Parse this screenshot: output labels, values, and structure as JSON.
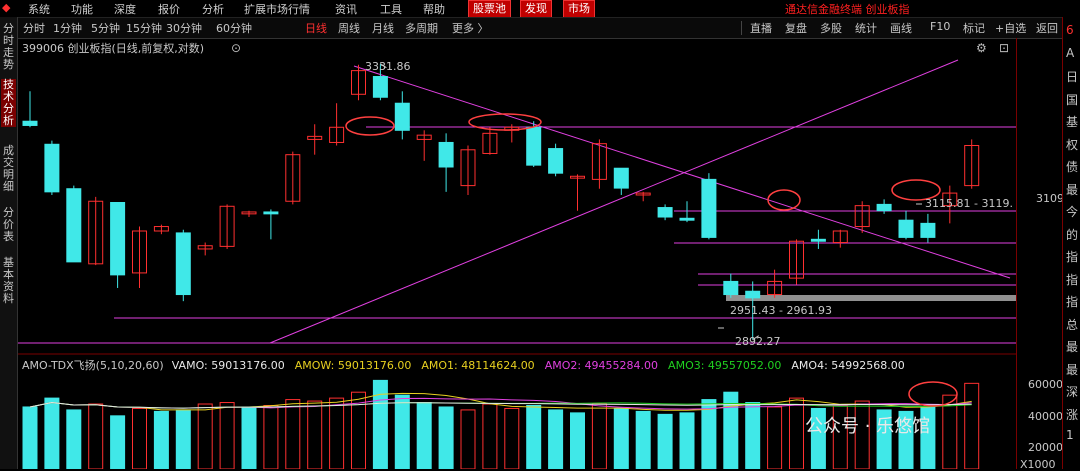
{
  "menu": {
    "items": [
      "系统",
      "功能",
      "深度",
      "报价",
      "分析",
      "扩展市场行情",
      "资讯",
      "工具",
      "帮助"
    ],
    "highlight": [
      "股票池",
      "发现",
      "市场"
    ],
    "right_text": "通达信金融终端  创业板指"
  },
  "toolbar": {
    "periods": [
      "分时",
      "1分钟",
      "5分钟",
      "15分钟",
      "30分钟",
      "60分钟",
      "日线",
      "周线",
      "月线",
      "多周期",
      "更多 〉"
    ],
    "active": "日线",
    "right": [
      "直播",
      "复盘",
      "多股",
      "统计",
      "画线",
      "F10",
      "标记",
      "+自选",
      "返回"
    ]
  },
  "left_tabs": [
    "分时走势",
    "技术分析",
    "成交明细",
    "分价表",
    "基本资料"
  ],
  "left_tab_active": "技术分析",
  "right_panel_chars": [
    "6",
    "A",
    "日",
    "国",
    "基",
    "权",
    "债",
    "最",
    "今",
    "的",
    "指",
    "指",
    "指",
    "总",
    "最",
    "最",
    "深",
    "涨",
    "1"
  ],
  "chart_title": "399006 创业板指(日线,前复权,对数)",
  "volume_legend": [
    {
      "text": "AMO-TDX飞扬(5,10,20,60)",
      "color": "#c8c8c8"
    },
    {
      "text": "VAMO: 59013176.00",
      "color": "#e8e8e8"
    },
    {
      "text": "AMOW: 59013176.00",
      "color": "#e8d020"
    },
    {
      "text": "AMO1: 48114624.00",
      "color": "#e8d020"
    },
    {
      "text": "AMO2: 49455284.00",
      "color": "#e040e0"
    },
    {
      "text": "AMO3: 49557052.00",
      "color": "#20d020"
    },
    {
      "text": "AMO4: 54992568.00",
      "color": "#e8e8e8"
    }
  ],
  "annotations": {
    "high": "3331.86",
    "low": "2892.27",
    "range1": "2951.43 - 2961.93",
    "range2": "3115.81 - 3119."
  },
  "price_axis": {
    "label": "3109"
  },
  "volume_axis": {
    "labels": [
      "60000",
      "40000",
      "20000"
    ],
    "unit": "X1000"
  },
  "watermark": "公众号 · 乐悠馆",
  "colors": {
    "up": "#ff3030",
    "down": "#40e8e8",
    "pink": "#e040e0",
    "bg": "#000000"
  },
  "chart_data": {
    "type": "candlestick",
    "candles": [
      {
        "o": 3235,
        "h": 3285,
        "l": 3225,
        "c": 3228
      },
      {
        "o": 3197,
        "h": 3203,
        "l": 3115,
        "c": 3120
      },
      {
        "o": 3125,
        "h": 3130,
        "l": 3010,
        "c": 3010
      },
      {
        "o": 3007,
        "h": 3112,
        "l": 3005,
        "c": 3105
      },
      {
        "o": 3103,
        "h": 3103,
        "l": 2970,
        "c": 2990
      },
      {
        "o": 2993,
        "h": 3065,
        "l": 2970,
        "c": 3058
      },
      {
        "o": 3058,
        "h": 3068,
        "l": 3053,
        "c": 3065
      },
      {
        "o": 3055,
        "h": 3060,
        "l": 2950,
        "c": 2960
      },
      {
        "o": 3030,
        "h": 3040,
        "l": 3020,
        "c": 3035
      },
      {
        "o": 3034,
        "h": 3100,
        "l": 3030,
        "c": 3097
      },
      {
        "o": 3085,
        "h": 3090,
        "l": 3080,
        "c": 3088
      },
      {
        "o": 3088,
        "h": 3092,
        "l": 3045,
        "c": 3085
      },
      {
        "o": 3105,
        "h": 3185,
        "l": 3100,
        "c": 3180
      },
      {
        "o": 3205,
        "h": 3230,
        "l": 3180,
        "c": 3210
      },
      {
        "o": 3200,
        "h": 3265,
        "l": 3195,
        "c": 3225
      },
      {
        "o": 3280,
        "h": 3330,
        "l": 3270,
        "c": 3320
      },
      {
        "o": 3310,
        "h": 3331.86,
        "l": 3270,
        "c": 3275
      },
      {
        "o": 3265,
        "h": 3285,
        "l": 3205,
        "c": 3220
      },
      {
        "o": 3205,
        "h": 3220,
        "l": 3170,
        "c": 3212
      },
      {
        "o": 3200,
        "h": 3215,
        "l": 3120,
        "c": 3160
      },
      {
        "o": 3130,
        "h": 3195,
        "l": 3115,
        "c": 3188
      },
      {
        "o": 3182,
        "h": 3225,
        "l": 3180,
        "c": 3215
      },
      {
        "o": 3220,
        "h": 3230,
        "l": 3200,
        "c": 3225
      },
      {
        "o": 3225,
        "h": 3235,
        "l": 3160,
        "c": 3163
      },
      {
        "o": 3190,
        "h": 3198,
        "l": 3145,
        "c": 3150
      },
      {
        "o": 3142,
        "h": 3148,
        "l": 3090,
        "c": 3145
      },
      {
        "o": 3140,
        "h": 3205,
        "l": 3125,
        "c": 3198
      },
      {
        "o": 3158,
        "h": 3158,
        "l": 3115,
        "c": 3126
      },
      {
        "o": 3115,
        "h": 3120,
        "l": 3105,
        "c": 3118
      },
      {
        "o": 3095,
        "h": 3100,
        "l": 3075,
        "c": 3080
      },
      {
        "o": 3078,
        "h": 3105,
        "l": 3072,
        "c": 3075
      },
      {
        "o": 3140,
        "h": 3150,
        "l": 3045,
        "c": 3048
      },
      {
        "o": 2980,
        "h": 2992,
        "l": 2955,
        "c": 2960
      },
      {
        "o": 2965,
        "h": 2980,
        "l": 2892.27,
        "c": 2955
      },
      {
        "o": 2960,
        "h": 2998,
        "l": 2955,
        "c": 2980
      },
      {
        "o": 2985,
        "h": 3045,
        "l": 2975,
        "c": 3042
      },
      {
        "o": 3045,
        "h": 3060,
        "l": 3030,
        "c": 3042
      },
      {
        "o": 3040,
        "h": 3060,
        "l": 3032,
        "c": 3058
      },
      {
        "o": 3065,
        "h": 3105,
        "l": 3055,
        "c": 3098
      },
      {
        "o": 3100,
        "h": 3108,
        "l": 3085,
        "c": 3090
      },
      {
        "o": 3075,
        "h": 3090,
        "l": 3045,
        "c": 3048
      },
      {
        "o": 3070,
        "h": 3085,
        "l": 3040,
        "c": 3048
      },
      {
        "o": 3098,
        "h": 3130,
        "l": 3070,
        "c": 3118
      },
      {
        "o": 3130,
        "h": 3205,
        "l": 3125,
        "c": 3195
      }
    ],
    "volume": [
      42000,
      48000,
      40000,
      44000,
      36000,
      41000,
      39000,
      40000,
      44000,
      45000,
      42000,
      43000,
      47000,
      46000,
      48000,
      52000,
      60000,
      50000,
      45000,
      42000,
      40000,
      44000,
      41000,
      43000,
      40000,
      38000,
      44000,
      41000,
      39000,
      37000,
      38000,
      47000,
      52000,
      45000,
      42000,
      48000,
      41000,
      43000,
      46000,
      40000,
      39000,
      42000,
      50000,
      58000
    ],
    "volume_up": [
      false,
      false,
      false,
      true,
      false,
      true,
      false,
      false,
      true,
      true,
      false,
      true,
      true,
      true,
      true,
      true,
      false,
      false,
      false,
      false,
      true,
      true,
      true,
      false,
      false,
      false,
      true,
      false,
      false,
      false,
      false,
      false,
      false,
      false,
      true,
      true,
      false,
      true,
      true,
      false,
      false,
      false,
      true,
      true
    ],
    "price_range": [
      2880,
      3345
    ],
    "volume_range": [
      0,
      65000
    ]
  }
}
